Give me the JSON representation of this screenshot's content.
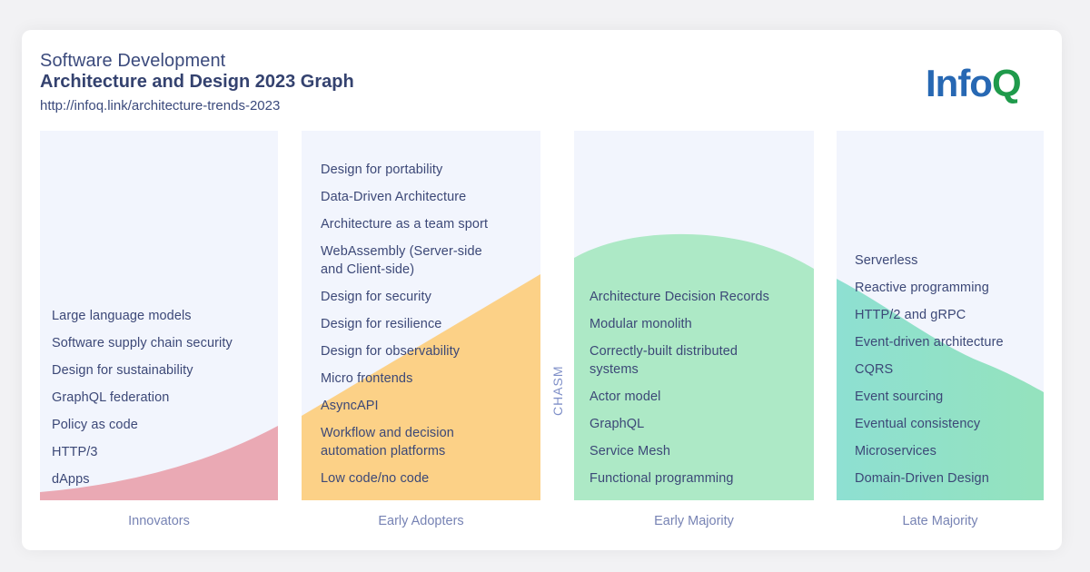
{
  "header": {
    "subtitle": "Software Development",
    "title": "Architecture and Design 2023 Graph",
    "url": "http://infoq.link/architecture-trends-2023"
  },
  "logo": {
    "part1": "Info",
    "part2": "Q",
    "colors": {
      "info": "#2768b3",
      "q": "#1f9a4b"
    }
  },
  "chasm_label": "CHASM",
  "columns": [
    {
      "label": "Innovators",
      "color": "#eaa9b4",
      "items": [
        "Large language models",
        "Software supply chain security",
        "Design for sustainability",
        "GraphQL federation",
        "Policy as code",
        "HTTP/3",
        "dApps"
      ]
    },
    {
      "label": "Early Adopters",
      "color": "#fcd187",
      "items": [
        "Design for portability",
        "Data-Driven Architecture",
        "Architecture as a team sport",
        "WebAssembly (Server-side and Client-side)",
        "Design for security",
        "Design for resilience",
        "Design for observability",
        "Micro frontends",
        "AsyncAPI",
        "Workflow and decision automation platforms",
        "Low code/no code"
      ]
    },
    {
      "label": "Early Majority",
      "color": "#ade9c6",
      "items": [
        "Architecture Decision Records",
        "Modular monolith",
        "Correctly-built distributed systems",
        "Actor model",
        "GraphQL",
        "Service Mesh",
        "Functional programming"
      ]
    },
    {
      "label": "Late Majority",
      "color": "#8de0cf",
      "items": [
        "Serverless",
        "Reactive programming",
        "HTTP/2 and gRPC",
        "Event-driven architecture",
        "CQRS",
        "Event sourcing",
        "Eventual consistency",
        "Microservices",
        "Domain-Driven Design"
      ]
    }
  ]
}
